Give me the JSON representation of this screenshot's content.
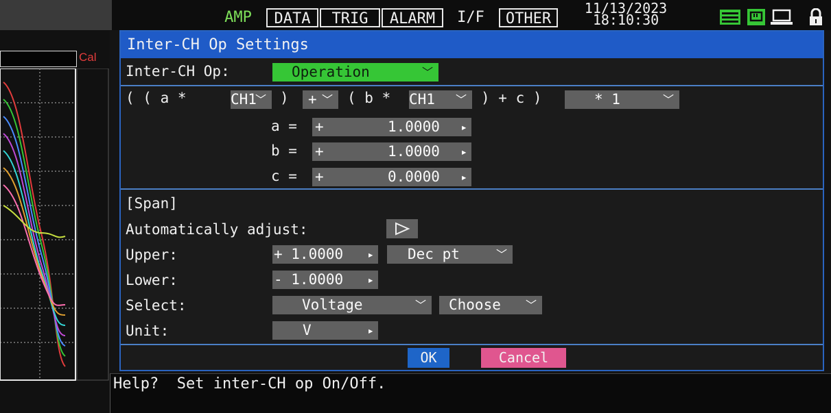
{
  "status_bar": {
    "tabs": [
      "AMP",
      "DATA",
      "TRIG",
      "ALARM",
      "I/F",
      "OTHER"
    ],
    "date": "11/13/2023",
    "time": "18:10:30",
    "accent_green": "#36c636",
    "icons": [
      "memory-icon",
      "sd-card-icon",
      "pc-connection-icon",
      "lock-icon"
    ]
  },
  "left_panel": {
    "cal_label": "Cal"
  },
  "dialog": {
    "title": "Inter-CH Op Settings",
    "op_label": "Inter-CH Op:",
    "op_value": "Operation",
    "formula": {
      "open": "( ( a * ",
      "ch1_a": "CH1",
      "close_paren": ")",
      "operator": "+",
      "mid": "( b * ",
      "ch1_b": "CH1",
      "tail": ") + c )",
      "multiplier": "* 1"
    },
    "coeffs": [
      {
        "label": "a =",
        "sign": "+",
        "value": "1.0000"
      },
      {
        "label": "b =",
        "sign": "+",
        "value": "1.0000"
      },
      {
        "label": "c =",
        "sign": "+",
        "value": "0.0000"
      }
    ],
    "span": {
      "header": "[Span]",
      "auto_label": "Automatically adjust:",
      "upper_label": "Upper:",
      "upper_value": "+ 1.0000",
      "decpt": "Dec pt",
      "lower_label": "Lower:",
      "lower_value": "- 1.0000",
      "select_label": "Select:",
      "select_value": "Voltage",
      "choose": "Choose",
      "unit_label": "Unit:",
      "unit_value": "V"
    },
    "ok": "OK",
    "cancel": "Cancel"
  },
  "help": {
    "text": "Help?  Set inter-CH op On/Off."
  }
}
